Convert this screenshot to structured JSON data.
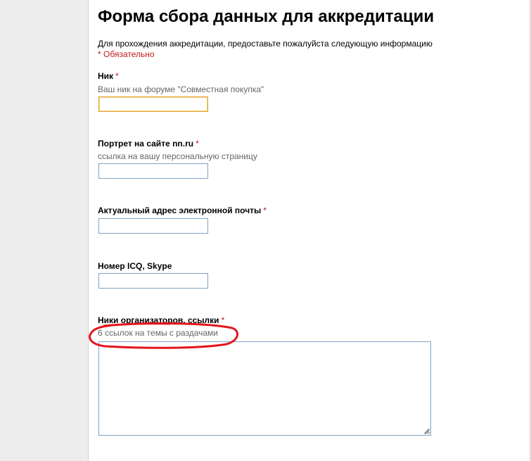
{
  "form": {
    "title": "Форма сбора данных для аккредитации",
    "description": "Для прохождения аккредитации, предоставьте пожалуйста следующую информацию",
    "required_note": "* Обязательно"
  },
  "fields": {
    "nick": {
      "label": "Ник",
      "required_mark": "*",
      "help": "Ваш ник на форуме \"Совместная покупка\"",
      "value": ""
    },
    "portrait": {
      "label": "Портрет на сайте nn.ru",
      "required_mark": "*",
      "help": "ссылка на вашу персональную страницу",
      "value": ""
    },
    "email": {
      "label": "Актуальный адрес электронной почты",
      "required_mark": "*",
      "value": ""
    },
    "icq_skype": {
      "label": "Номер ICQ, Skype",
      "value": ""
    },
    "organizers": {
      "label": "Ники организаторов, ссылки",
      "required_mark": "*",
      "help": "6 ссылок на темы с раздачами",
      "value": ""
    }
  },
  "colors": {
    "required": "#c11b17",
    "input_border": "#7fa3c6",
    "focus_border": "#e5a530",
    "annotation": "#e3141c"
  }
}
